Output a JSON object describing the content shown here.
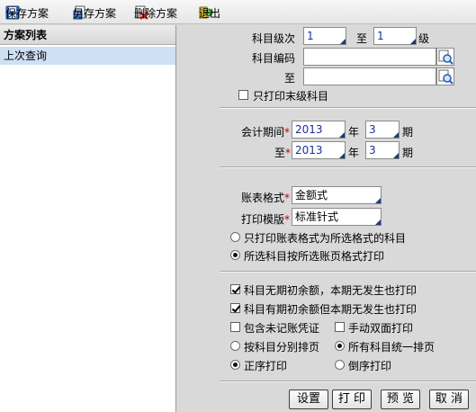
{
  "toolbar": {
    "save": "保存方案",
    "save_as": "另存方案",
    "delete": "删除方案",
    "exit": "退出"
  },
  "plan_list": {
    "title": "方案列表",
    "items": [
      "上次查询"
    ]
  },
  "subject_level": {
    "label": "科目级次",
    "from": "1",
    "to_label": "至",
    "to": "1",
    "suffix": "级"
  },
  "subject_code": {
    "label": "科目编码",
    "to_label": "至",
    "from": "",
    "to": ""
  },
  "only_last_level": {
    "label": "只打印末级科目",
    "checked": false
  },
  "period": {
    "label": "会计期间",
    "req": "*",
    "from_year": "2013",
    "from_month": "3",
    "to_label": "至",
    "to_year": "2013",
    "to_month": "3",
    "year_label": "年",
    "month_label": "期"
  },
  "format": {
    "label": "账表格式",
    "req": "*",
    "value": "金额式"
  },
  "template": {
    "label": "打印模版",
    "req": "*",
    "value": "标准针式"
  },
  "format_options": [
    {
      "label": "只打印账表格式为所选格式的科目",
      "selected": false
    },
    {
      "label": "所选科目按所选账页格式打印",
      "selected": true
    }
  ],
  "print_options": {
    "no_opening_no_current": {
      "label": "科目无期初余额，本期无发生也打印",
      "checked": true
    },
    "has_opening_no_current": {
      "label": "科目有期初余额但本期无发生也打印",
      "checked": true
    },
    "include_unposted": {
      "label": "包含未记账凭证",
      "checked": false
    },
    "manual_duplex": {
      "label": "手动双面打印",
      "checked": false
    }
  },
  "paging": [
    {
      "label": "按科目分别排页",
      "selected": false
    },
    {
      "label": "所有科目统一排页",
      "selected": true
    }
  ],
  "order": [
    {
      "label": "正序打印",
      "selected": true
    },
    {
      "label": "倒序打印",
      "selected": false
    }
  ],
  "buttons": {
    "settings": "设置",
    "print": "打 印",
    "preview": "预 览",
    "cancel": "取 消"
  },
  "colors": {
    "selection": "#cfe0f5",
    "required": "#c00000",
    "input_text": "#1c2f9e"
  }
}
